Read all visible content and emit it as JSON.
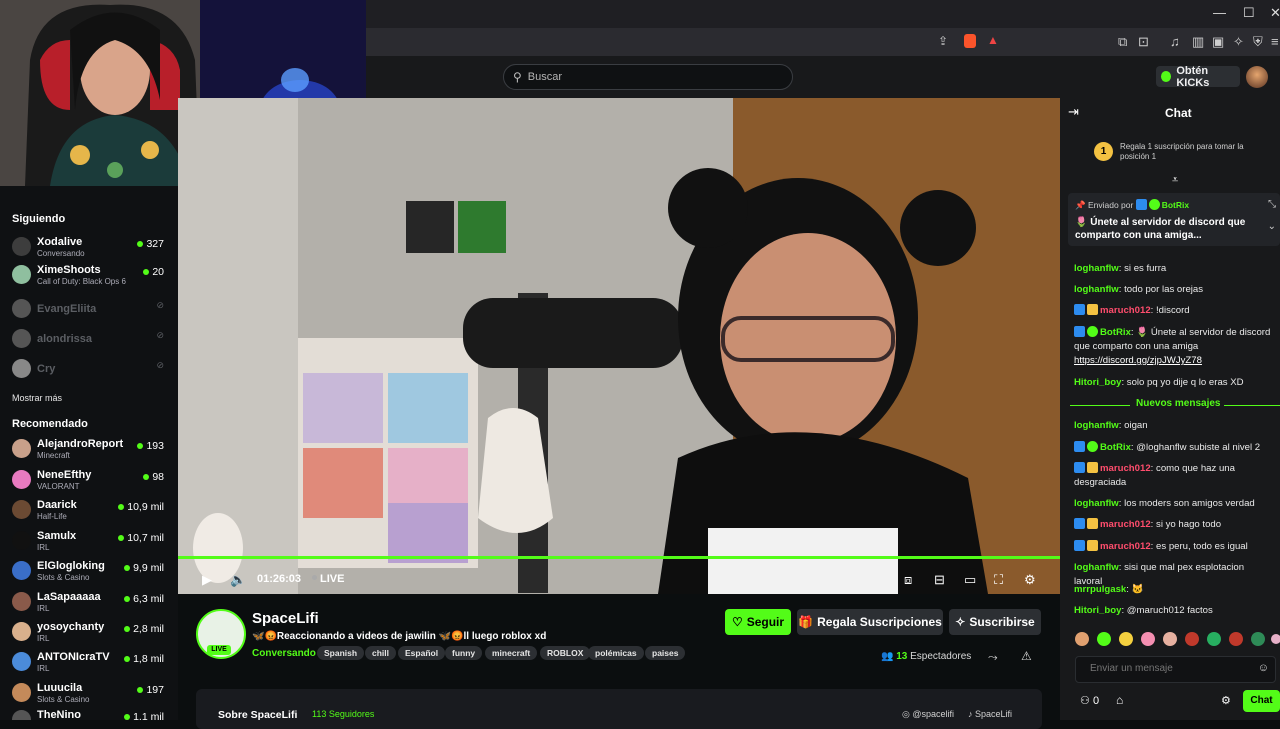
{
  "header": {
    "search_placeholder": "Buscar",
    "kicks_label": "Obtén KICKs"
  },
  "sidebar": {
    "following_title": "Siguiendo",
    "following": [
      {
        "name": "Xodalive",
        "category": "Conversando",
        "viewers": "327",
        "avatar_color": "#3d3d3d"
      },
      {
        "name": "XimeShoots",
        "category": "Call of Duty: Black Ops 6",
        "viewers": "20",
        "avatar_color": "#8fbf9f"
      },
      {
        "name": "EvangEliita",
        "offline": true
      },
      {
        "name": "alondrissa",
        "offline": true
      },
      {
        "name": "Cry",
        "offline": true
      }
    ],
    "show_more": "Mostrar más",
    "recommended_title": "Recomendado",
    "recommended": [
      {
        "name": "AlejandroReport",
        "category": "Minecraft",
        "viewers": "193",
        "avatar_color": "#c8a08a"
      },
      {
        "name": "NeneEfthy",
        "category": "VALORANT",
        "viewers": "98",
        "avatar_color": "#e87ac0"
      },
      {
        "name": "Daarick",
        "category": "Half-Life",
        "viewers": "10,9 mil",
        "avatar_color": "#6b4a33"
      },
      {
        "name": "Samulx",
        "category": "IRL",
        "viewers": "10,7 mil",
        "avatar_color": "#111111"
      },
      {
        "name": "ElGlogloking",
        "category": "Slots & Casino",
        "viewers": "9,9 mil",
        "avatar_color": "#3a6ec8"
      },
      {
        "name": "LaSapaaaaa",
        "category": "IRL",
        "viewers": "6,3 mil",
        "avatar_color": "#8a5a4a"
      },
      {
        "name": "yosoychanty",
        "category": "IRL",
        "viewers": "2,8 mil",
        "avatar_color": "#d9b08c"
      },
      {
        "name": "ANTONIcraTV",
        "category": "IRL",
        "viewers": "1,8 mil",
        "avatar_color": "#4b8bd9"
      },
      {
        "name": "Luuucila",
        "category": "Slots & Casino",
        "viewers": "197",
        "avatar_color": "#c48a5a"
      },
      {
        "name": "TheNino",
        "category": "",
        "viewers": "1,1 mil",
        "avatar_color": "#555555"
      }
    ]
  },
  "player": {
    "time": "01:26:03",
    "live": "LIVE"
  },
  "stream": {
    "channel": "SpaceLifi",
    "title": "🦋😡Reaccionando a videos de jawilin 🦋😡ll luego roblox xd",
    "category": "Conversando",
    "tags": [
      "Spanish",
      "chill",
      "Español",
      "funny",
      "minecraft",
      "ROBLOX",
      "polémicas",
      "paises"
    ],
    "live_badge": "LIVE",
    "follow": "Seguir",
    "gift_subs": "Regala Suscripciones",
    "subscribe": "Suscribirse",
    "viewers_count": "13",
    "viewers_label": "Espectadores",
    "about_title": "Sobre SpaceLifi",
    "followers": "113 Seguidores",
    "social_instagram": "@spacelifi",
    "social_tiktok": "SpaceLifi"
  },
  "chat": {
    "title": "Chat",
    "gift_rank": "1",
    "gift_text": "Regala 1 suscripción para tomar la posición 1",
    "pinned_by_label": "Enviado por",
    "pinned_user": "BotRix",
    "pinned_message": "🌷 Únete al servidor de discord que comparto con una amiga...",
    "messages": [
      {
        "user": "loghanflw",
        "color": "#53fc18",
        "text": "si es furra",
        "badges": []
      },
      {
        "user": "loghanflw",
        "color": "#53fc18",
        "text": "todo por las orejas",
        "badges": []
      },
      {
        "user": "maruch012",
        "color": "#ff4d6d",
        "text": "!discord",
        "badges": [
          "#2d8cf0",
          "#f4c242"
        ]
      },
      {
        "user": "BotRix",
        "color": "#53fc18",
        "text": "🌷 Únete al servidor de discord que comparto con una amiga",
        "link": "https://discord.gg/zjpJWJyZ78",
        "badges": [
          "#2d8cf0",
          "#53fc18"
        ]
      },
      {
        "user": "Hitori_boy",
        "color": "#53fc18",
        "text": "solo pq yo dije q lo eras XD",
        "badges": []
      },
      {
        "user": "loghanflw",
        "color": "#53fc18",
        "text": "oigan",
        "badges": []
      },
      {
        "user": "BotRix",
        "color": "#53fc18",
        "text": "@loghanflw subiste al nivel 2",
        "badges": [
          "#2d8cf0",
          "#53fc18"
        ]
      },
      {
        "user": "maruch012",
        "color": "#ff4d6d",
        "text": "como que haz una desgraciada",
        "badges": [
          "#2d8cf0",
          "#f4c242"
        ]
      },
      {
        "user": "loghanflw",
        "color": "#53fc18",
        "text": "los moders son amigos verdad",
        "badges": []
      },
      {
        "user": "maruch012",
        "color": "#ff4d6d",
        "text": "si yo hago todo",
        "badges": [
          "#2d8cf0",
          "#f4c242"
        ]
      },
      {
        "user": "maruch012",
        "color": "#ff4d6d",
        "text": "es peru, todo es igual",
        "badges": [
          "#2d8cf0",
          "#f4c242"
        ]
      },
      {
        "user": "loghanflw",
        "color": "#53fc18",
        "text": "sisi que mal pex esplotacion lavoral",
        "badges": []
      },
      {
        "user": "mrrpulgask",
        "color": "#53fc18",
        "text": "🐱",
        "badges": []
      },
      {
        "user": "Hitori_boy",
        "color": "#53fc18",
        "text": "@maruch012 factos",
        "badges": []
      }
    ],
    "new_messages": "Nuevos mensajes",
    "input_placeholder": "Enviar un mensaje",
    "kicks_count": "0",
    "send": "Chat"
  }
}
